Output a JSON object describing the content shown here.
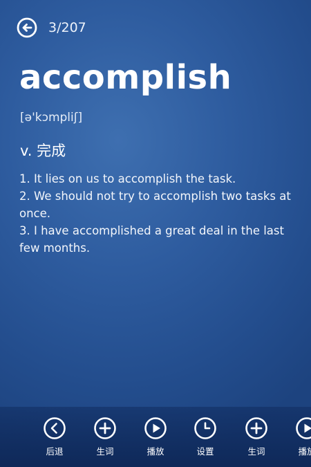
{
  "header": {
    "counter": "3/207",
    "back_icon": "back-arrow-circle-icon"
  },
  "entry": {
    "word": "accomplish",
    "phonetic": "[ə'kɔmpliʃ]",
    "definition": "v. 完成",
    "examples": [
      "1. It lies on us to accomplish the task.",
      "2. We should not try to accomplish two tasks at once.",
      "3. I have accomplished a great deal in the last few months."
    ]
  },
  "toolbar": {
    "items": [
      {
        "label": "后退",
        "icon": "back-chevron-icon"
      },
      {
        "label": "生词",
        "icon": "plus-circle-icon"
      },
      {
        "label": "播放",
        "icon": "play-icon"
      },
      {
        "label": "设置",
        "icon": "clock-icon"
      },
      {
        "label": "生词",
        "icon": "plus-circle-icon"
      },
      {
        "label": "播放",
        "icon": "play-icon"
      }
    ]
  },
  "colors": {
    "background": "#2e5c9f",
    "text": "#ffffff"
  }
}
